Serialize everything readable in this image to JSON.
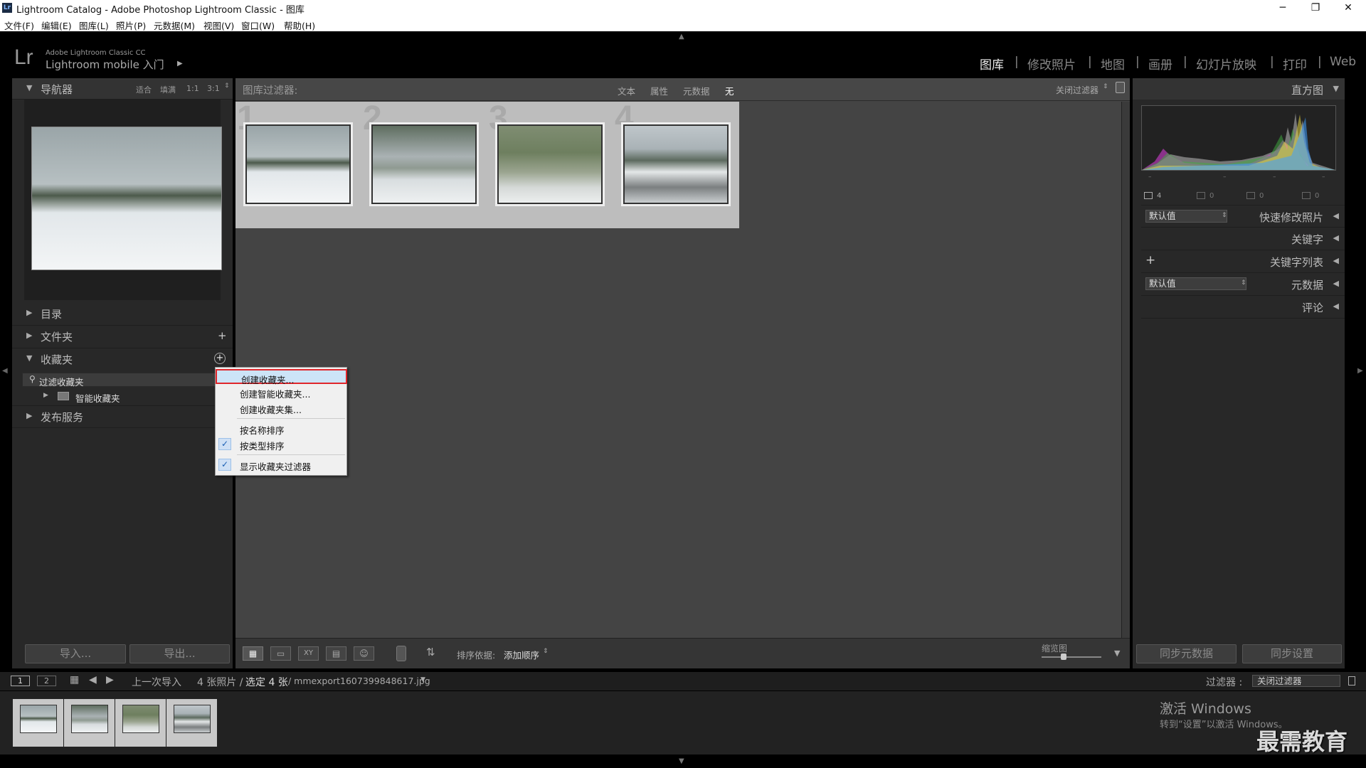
{
  "window": {
    "title": "Lightroom Catalog - Adobe Photoshop Lightroom Classic - 图库",
    "app_icon": "Lr",
    "minimize": "─",
    "maximize": "❐",
    "close": "✕"
  },
  "menubar": [
    "文件(F)",
    "编辑(E)",
    "图库(L)",
    "照片(P)",
    "元数据(M)",
    "视图(V)",
    "窗口(W)",
    "帮助(H)"
  ],
  "identity": {
    "logo": "Lr",
    "line1": "Adobe Lightroom Classic CC",
    "line2": "Lightroom mobile 入门"
  },
  "modules": [
    "图库",
    "修改照片",
    "地图",
    "画册",
    "幻灯片放映",
    "打印",
    "Web"
  ],
  "navigator": {
    "title": "导航器",
    "zooms": [
      "适合",
      "填满",
      "1:1",
      "3:1"
    ]
  },
  "left_sections": {
    "catalog": "目录",
    "folders": "文件夹",
    "collections": "收藏夹",
    "filter_collections": "过滤收藏夹",
    "smart_collections": "智能收藏夹",
    "publish": "发布服务"
  },
  "context_menu": {
    "items": [
      "创建收藏夹...",
      "创建智能收藏夹...",
      "创建收藏夹集...",
      "按名称排序",
      "按类型排序",
      "显示收藏夹过滤器"
    ]
  },
  "filter_bar": {
    "title": "图库过滤器:",
    "options": [
      "文本",
      "属性",
      "元数据",
      "无"
    ],
    "close": "关闭过滤器"
  },
  "grid": {
    "cells": [
      "1",
      "2",
      "3",
      "4"
    ]
  },
  "toolbar": {
    "sort_label": "排序依据:",
    "sort_value": "添加顺序",
    "thumb_label": "缩览图"
  },
  "left_buttons": {
    "import": "导入...",
    "export": "导出..."
  },
  "histogram": {
    "title": "直方图",
    "stats": [
      "4",
      "0",
      "0",
      "0"
    ]
  },
  "right_sections": {
    "quick_develop": "快速修改照片",
    "quick_develop_preset": "默认值",
    "keywords": "关键字",
    "keyword_list": "关键字列表",
    "metadata": "元数据",
    "metadata_preset": "默认值",
    "comments": "评论"
  },
  "right_buttons": {
    "sync_metadata": "同步元数据",
    "sync_settings": "同步设置"
  },
  "filmstrip_bar": {
    "view1": "1",
    "view2": "2",
    "source": "上一次导入",
    "count": "4 张照片 /",
    "selected": "选定 4 张",
    "filename": "/ mmexport1607399848617.jpg",
    "filter_label": "过滤器 :",
    "filter_value": "关闭过滤器"
  },
  "watermark": {
    "activate": "激活 Windows",
    "activate_sub": "转到“设置”以激活 Windows。",
    "brand": "最需教育"
  }
}
